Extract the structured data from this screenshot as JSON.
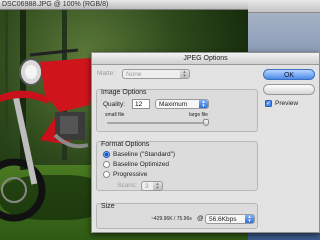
{
  "photo_window": {
    "title": "DSC06988.JPG @ 100% (RGB/8)"
  },
  "dialog": {
    "title": "JPEG Options",
    "matte": {
      "label": "Matte:",
      "value": "None"
    },
    "image_options": {
      "title": "Image Options",
      "quality_label": "Quality:",
      "quality_value": "12",
      "quality_preset": "Maximum",
      "small_file_label": "small file",
      "large_file_label": "large file"
    },
    "format_options": {
      "title": "Format Options",
      "options": [
        "Baseline (\"Standard\")",
        "Baseline Optimized",
        "Progressive"
      ],
      "selected_index": 0,
      "scans_label": "Scans:",
      "scans_value": "3"
    },
    "size": {
      "title": "Size",
      "readout": "~429.96K / 75.96s",
      "at_label": "@",
      "rate": "56.6Kbps"
    },
    "buttons": {
      "ok": "OK",
      "cancel": ""
    },
    "preview": {
      "label": "Preview",
      "checked": true
    }
  }
}
